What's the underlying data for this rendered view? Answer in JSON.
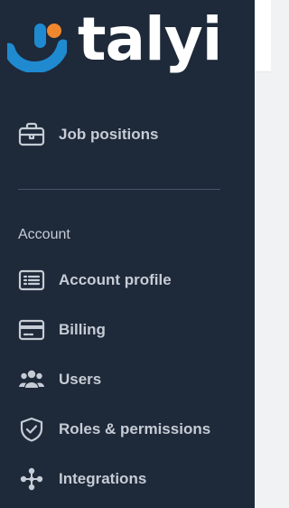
{
  "brand": {
    "name": "talyi",
    "colors": {
      "sidebar_bg": "#1e2939",
      "logo_blue": "#1f8ad0",
      "logo_orange": "#f0872e",
      "text_muted": "#c6ccd5"
    }
  },
  "nav": {
    "top_items": [
      {
        "label": "Job positions",
        "icon": "briefcase-icon"
      }
    ],
    "account_section": {
      "title": "Account",
      "items": [
        {
          "label": "Account profile",
          "icon": "list-card-icon"
        },
        {
          "label": "Billing",
          "icon": "credit-card-icon"
        },
        {
          "label": "Users",
          "icon": "users-icon"
        },
        {
          "label": "Roles & permissions",
          "icon": "shield-check-icon"
        },
        {
          "label": "Integrations",
          "icon": "integrations-icon"
        }
      ]
    }
  }
}
